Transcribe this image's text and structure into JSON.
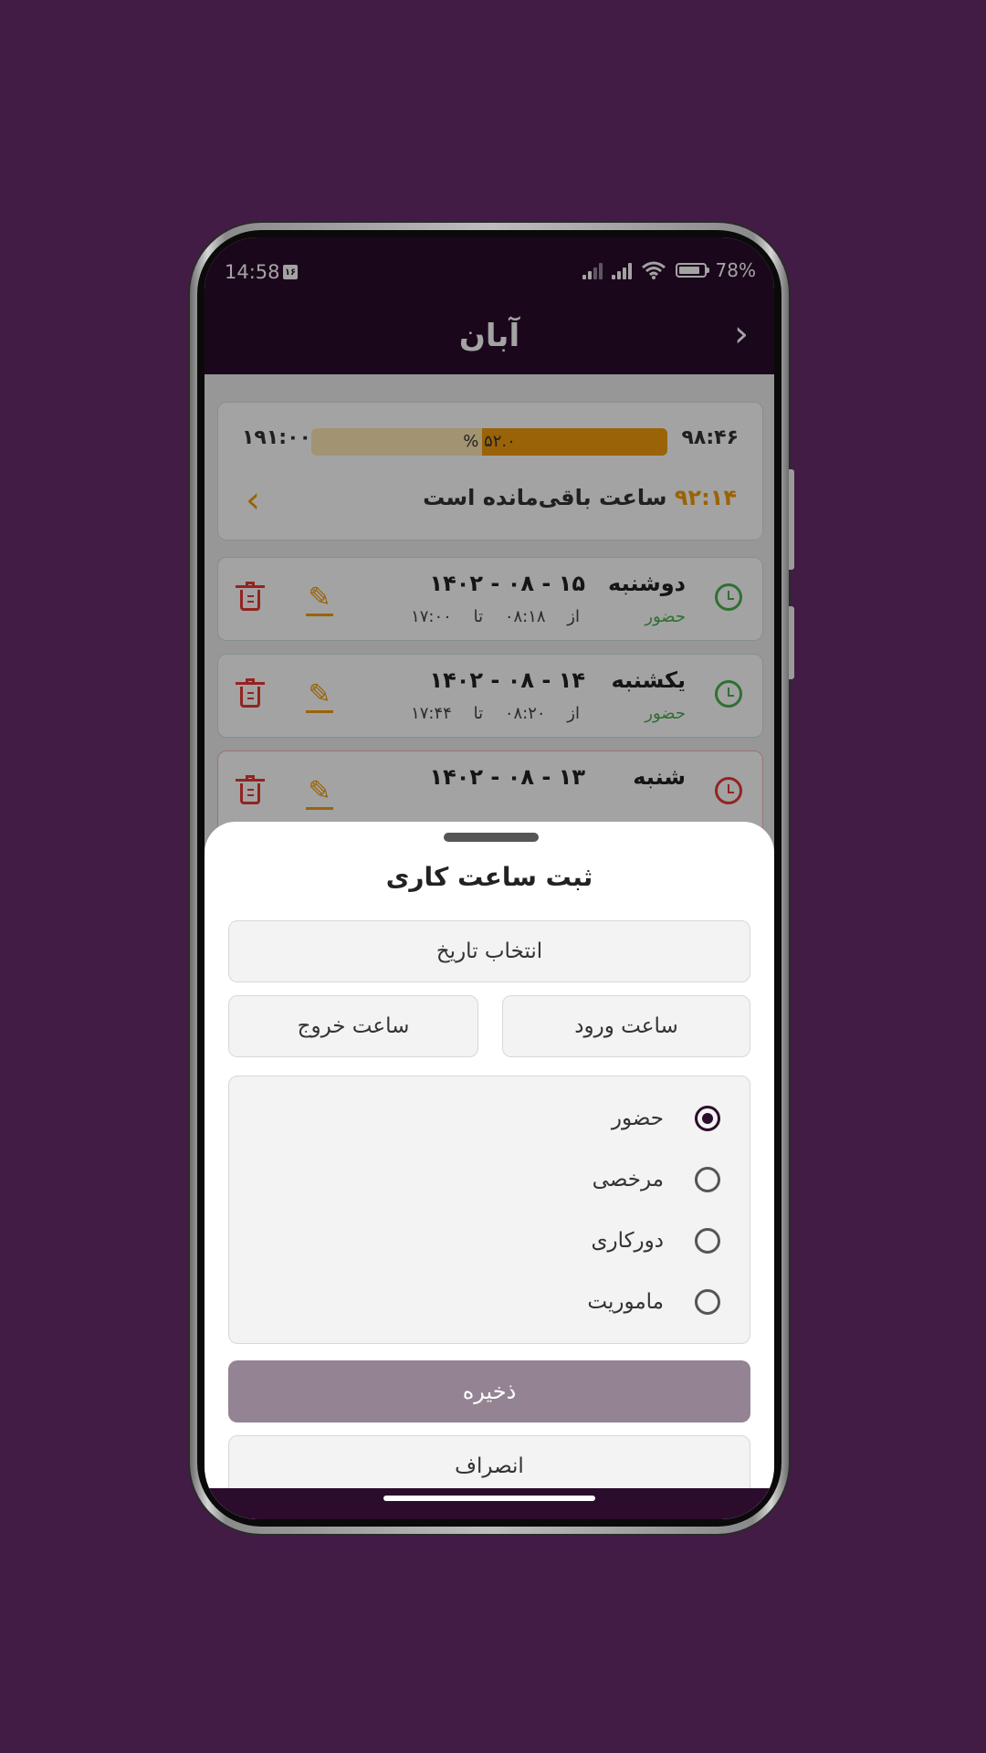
{
  "status_bar": {
    "time": "14:58",
    "calendar_badge": "۱۶",
    "battery": "78%"
  },
  "header": {
    "title": "آبان",
    "back_icon": "chevron-right-icon"
  },
  "summary": {
    "total_hours": "۱۹۱:۰۰",
    "worked_hours": "۹۸:۴۶",
    "progress_label": "% ۵۲.۰",
    "progress_fraction": 0.52,
    "remaining_value": "۹۲:۱۴",
    "remaining_label": "ساعت باقی‌مانده است"
  },
  "days": [
    {
      "name": "دوشنبه",
      "date": "۱۴۰۲ - ۰۸ - ۱۵",
      "status": "حضور",
      "from_label": "از",
      "from": "۰۸:۱۸",
      "to_label": "تا",
      "to": "۱۷:۰۰"
    },
    {
      "name": "یکشنبه",
      "date": "۱۴۰۲ - ۰۸ - ۱۴",
      "status": "حضور",
      "from_label": "از",
      "from": "۰۸:۲۰",
      "to_label": "تا",
      "to": "۱۷:۴۴"
    },
    {
      "name": "شنبه",
      "date": "۱۴۰۲ - ۰۸ - ۱۳"
    }
  ],
  "sheet": {
    "title": "ثبت ساعت کاری",
    "date_picker": "انتخاب تاریخ",
    "entry_time": "ساعت ورود",
    "exit_time": "ساعت خروج",
    "options": [
      "حضور",
      "مرخصی",
      "دورکاری",
      "ماموریت"
    ],
    "selected_option": "حضور",
    "save": "ذخیره",
    "cancel": "انصراف"
  },
  "colors": {
    "brand": "#2b0c2c",
    "accent": "#f19c0b",
    "success": "#4caf50",
    "danger": "#e53935",
    "save_button": "#938393"
  }
}
